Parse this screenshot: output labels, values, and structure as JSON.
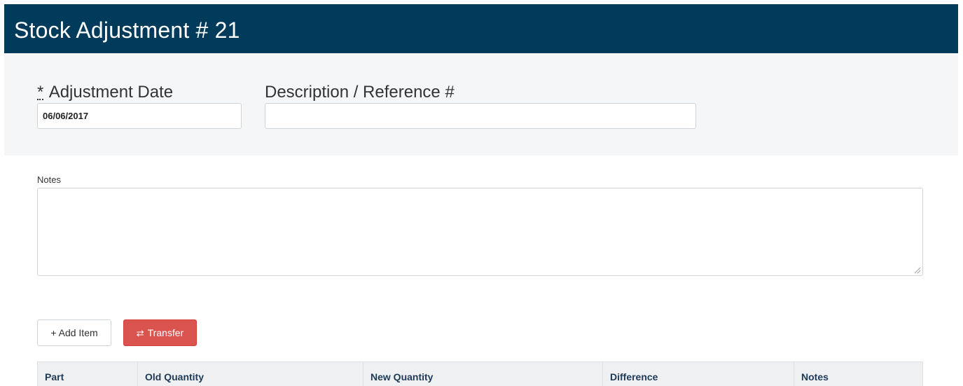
{
  "header": {
    "title": "Stock Adjustment # 21"
  },
  "form": {
    "date_label_req": "*",
    "date_label": "Adjustment Date",
    "date_value": "06/06/2017",
    "description_label": "Description / Reference #",
    "description_value": ""
  },
  "notes": {
    "label": "Notes",
    "value": ""
  },
  "buttons": {
    "add_item": "+ Add Item",
    "transfer": "Transfer",
    "transfer_icon": "⇄"
  },
  "table": {
    "columns": [
      "Part",
      "Old Quantity",
      "New Quantity",
      "Difference",
      "Notes"
    ]
  },
  "colors": {
    "header_bg": "#003b5c",
    "transfer_bg": "#d9534f"
  }
}
